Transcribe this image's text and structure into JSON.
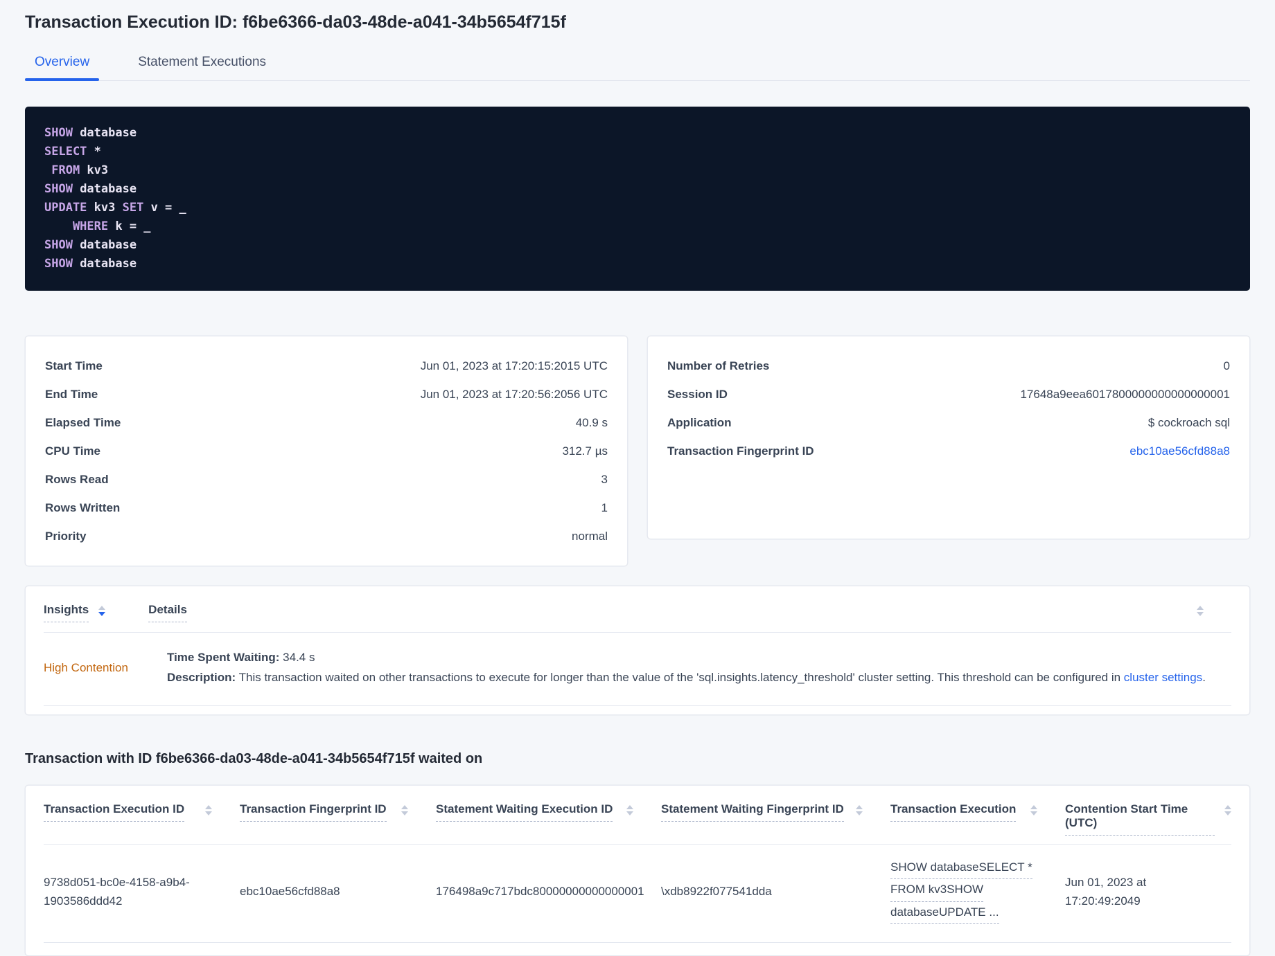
{
  "page": {
    "title": "Transaction Execution ID: f6be6366-da03-48de-a041-34b5654f715f"
  },
  "tabs": {
    "overview": "Overview",
    "statement_executions": "Statement Executions"
  },
  "colors": {
    "page_bg": "#f5f7fa",
    "accent_blue": "#2563eb",
    "insight_orange": "#c2660e",
    "code_bg": "#0c1628",
    "code_keyword": "#c7a6e8",
    "code_text": "#e9e5f4",
    "text_dark": "#242a35",
    "text_body": "#394455"
  },
  "sql_box": {
    "lines": [
      {
        "tokens": [
          {
            "t": "SHOW"
          },
          {
            "t": " database"
          }
        ]
      },
      {
        "tokens": [
          {
            "t": "SELECT"
          },
          {
            "t": " *"
          }
        ]
      },
      {
        "tokens": [
          {
            "t": " FROM"
          },
          {
            "t": " kv3"
          }
        ]
      },
      {
        "tokens": [
          {
            "t": "SHOW"
          },
          {
            "t": " database"
          }
        ]
      },
      {
        "tokens": [
          {
            "t": "UPDATE"
          },
          {
            "t": " kv3"
          },
          {
            "t": " SET"
          },
          {
            "t": " v = _"
          }
        ]
      },
      {
        "tokens": [
          {
            "t": "    WHERE"
          },
          {
            "t": " k = _"
          }
        ]
      },
      {
        "tokens": [
          {
            "t": "SHOW"
          },
          {
            "t": " database"
          }
        ]
      },
      {
        "tokens": [
          {
            "t": "SHOW"
          },
          {
            "t": " database"
          }
        ]
      }
    ]
  },
  "summary_left": {
    "rows": [
      {
        "label": "Start Time",
        "value": "Jun 01, 2023 at 17:20:15:2015 UTC"
      },
      {
        "label": "End Time",
        "value": "Jun 01, 2023 at 17:20:56:2056 UTC"
      },
      {
        "label": "Elapsed Time",
        "value": "40.9 s"
      },
      {
        "label": "CPU Time",
        "value": "312.7 µs"
      },
      {
        "label": "Rows Read",
        "value": "3"
      },
      {
        "label": "Rows Written",
        "value": "1"
      },
      {
        "label": "Priority",
        "value": "normal"
      }
    ]
  },
  "summary_right": {
    "rows": [
      {
        "label": "Number of Retries",
        "value": "0"
      },
      {
        "label": "Session ID",
        "value": "17648a9eea6017800000000000000001"
      },
      {
        "label": "Application",
        "value": "$ cockroach sql"
      },
      {
        "label": "Transaction Fingerprint ID",
        "value": "ebc10ae56cfd88a8"
      }
    ]
  },
  "insights": {
    "col_insights": "Insights",
    "col_details": "Details",
    "row": {
      "insight": "High Contention",
      "waiting_label": "Time Spent Waiting:",
      "waiting_value": " 34.4 s",
      "desc_label": "Description:",
      "desc_text": " This transaction waited on other transactions to execute for longer than the value of the 'sql.insights.latency_threshold' cluster setting. This threshold can be configured in ",
      "desc_link": "cluster settings",
      "desc_after": "."
    }
  },
  "waited_section": {
    "heading": "Transaction with ID f6be6366-da03-48de-a041-34b5654f715f waited on",
    "columns": [
      "Transaction Execution ID",
      "Transaction Fingerprint ID",
      "Statement Waiting Execution ID",
      "Statement Waiting Fingerprint ID",
      "Transaction Execution",
      "Contention Start Time (UTC)"
    ],
    "row": {
      "txn_execution_id": "9738d051-bc0e-4158-a9b4-1903586ddd42",
      "txn_fingerprint_id": "ebc10ae56cfd88a8",
      "stmt_waiting_execution_id": "176498a9c717bdc80000000000000001",
      "stmt_waiting_fingerprint_id": "\\xdb8922f077541dda",
      "transaction_execution_lines": [
        "SHOW databaseSELECT *",
        "FROM kv3SHOW",
        "databaseUPDATE ..."
      ],
      "contention_start_time": "Jun 01, 2023 at 17:20:49:2049"
    }
  }
}
